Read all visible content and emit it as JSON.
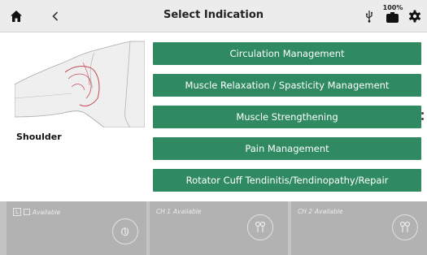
{
  "header": {
    "title": "Select Indication",
    "battery_percent": "100%",
    "icons": [
      "home-icon",
      "back-icon",
      "usb-icon",
      "battery-icon",
      "gear-icon"
    ]
  },
  "body_region": {
    "label": "Shoulder"
  },
  "indications": [
    {
      "label": "Circulation Management"
    },
    {
      "label": "Muscle Relaxation / Spasticity Management"
    },
    {
      "label": "Muscle Strengthening"
    },
    {
      "label": "Pain Management"
    },
    {
      "label": "Rotator Cuff Tendinitis/Tendinopathy/Repair"
    }
  ],
  "channels": [
    {
      "label": "L",
      "status": "Available",
      "icon": "hand-icon"
    },
    {
      "label": "CH 1",
      "status": "Available",
      "icon": "electrodes-icon"
    },
    {
      "label": "CH 2",
      "status": "Available",
      "icon": "electrodes-icon"
    }
  ],
  "colors": {
    "accent": "#2f8a62",
    "header_bg": "#ececec",
    "channel_bg": "#b2b2b2"
  }
}
